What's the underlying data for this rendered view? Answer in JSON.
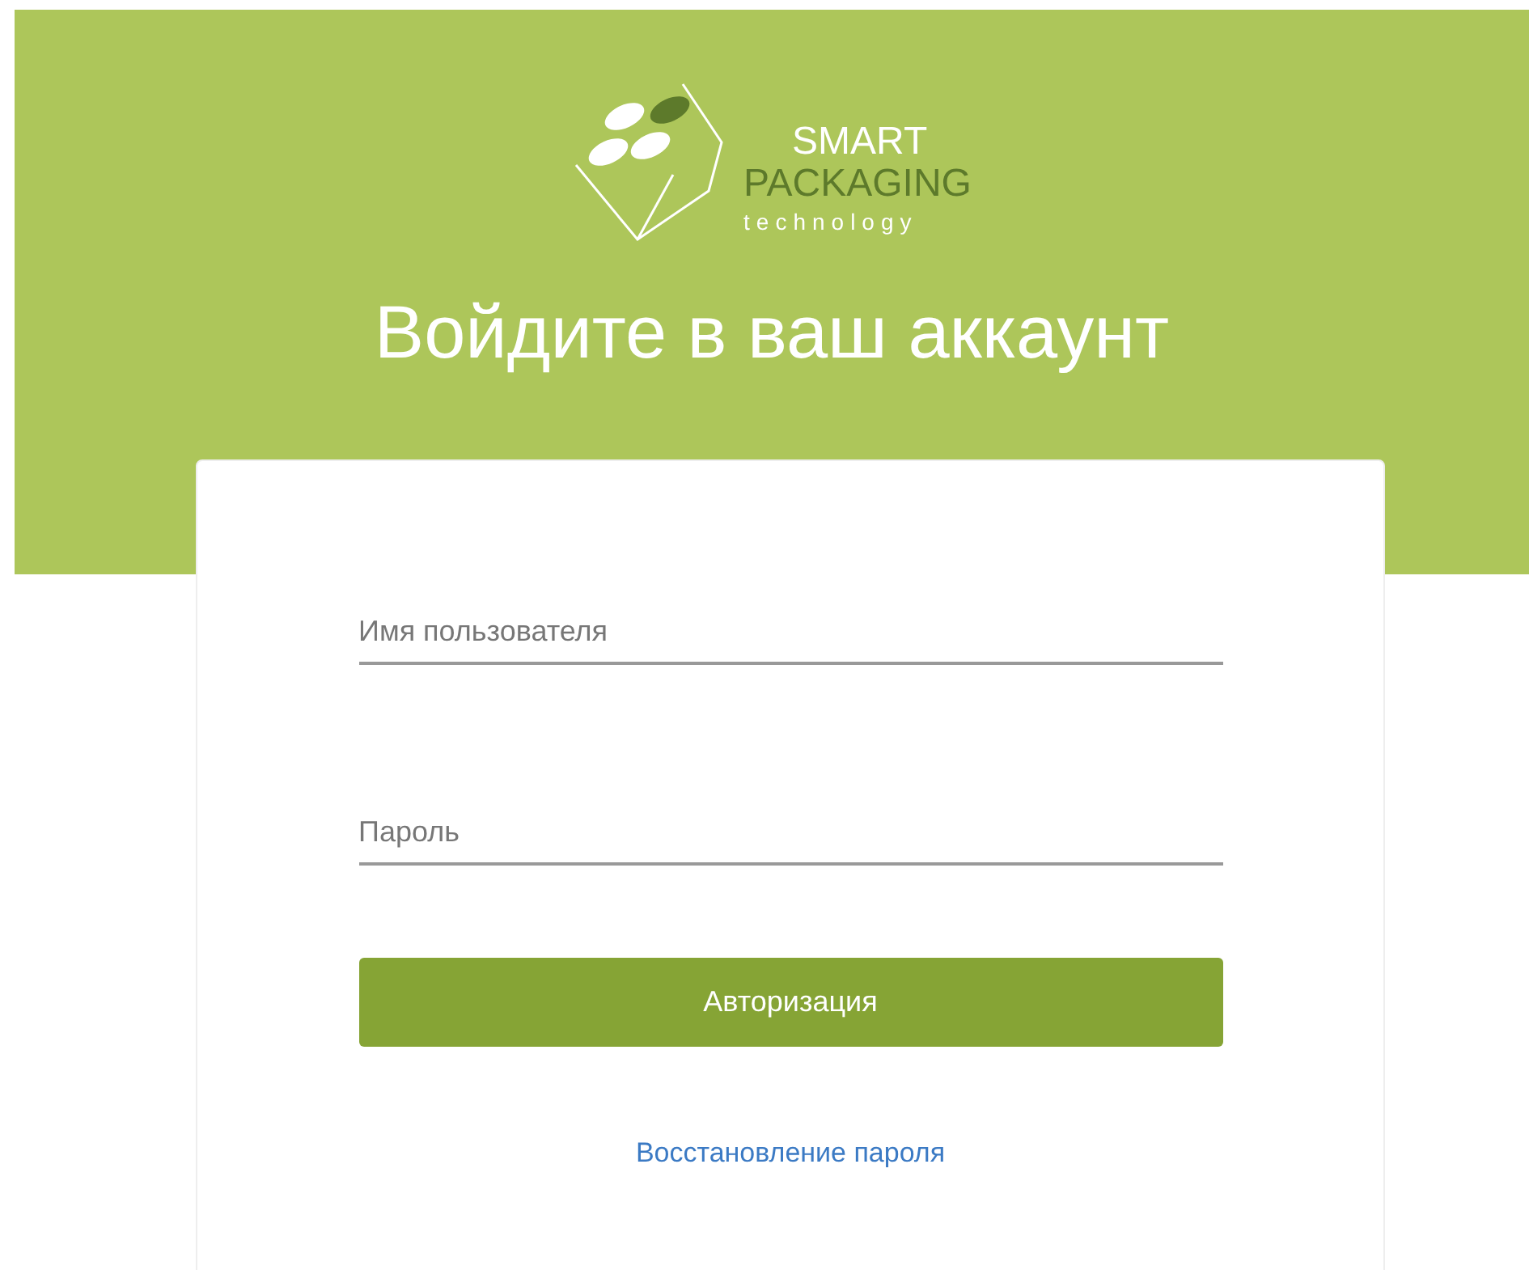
{
  "logo": {
    "line_1": "SMART",
    "line_2": "PACKAGING",
    "line_3": "technology"
  },
  "heading": "Войдите в ваш аккаунт",
  "fields": [
    {
      "placeholder": "Имя пользователя"
    },
    {
      "placeholder": "Пароль"
    }
  ],
  "submit_button": "Авторизация",
  "recover_link": "Восстановление пароля"
}
